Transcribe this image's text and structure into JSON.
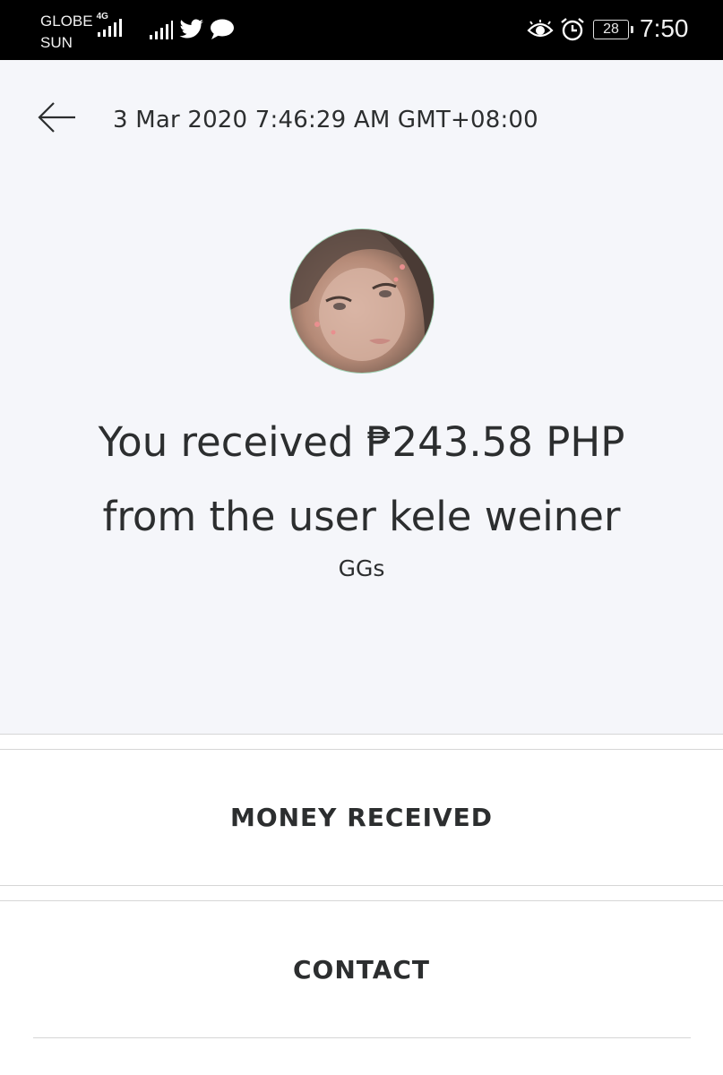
{
  "status_bar": {
    "carrier_1": "GLOBE",
    "carrier_1_network": "4G",
    "carrier_2": "SUN",
    "battery_level": "28",
    "time": "7:50",
    "icons": [
      "signal-icon",
      "signal-icon",
      "twitter-icon",
      "message-bubble-icon",
      "eye-icon",
      "alarm-icon",
      "battery-icon"
    ]
  },
  "header": {
    "back_icon": "arrow-left-icon",
    "timestamp": "3 Mar 2020 7:46:29 AM GMT+08:00"
  },
  "transaction": {
    "headline_line1": "You received ₱243.58 PHP",
    "headline_line2": "from the user kele weiner",
    "note": "GGs"
  },
  "sections": {
    "money_received": "MONEY RECEIVED",
    "contact": "CONTACT"
  },
  "colors": {
    "status_bar_bg": "#000000",
    "detail_bg": "#f5f6fa",
    "text": "#2c2e2f",
    "avatar_ring": "#9fd0b3",
    "divider": "#d6d6d6"
  }
}
